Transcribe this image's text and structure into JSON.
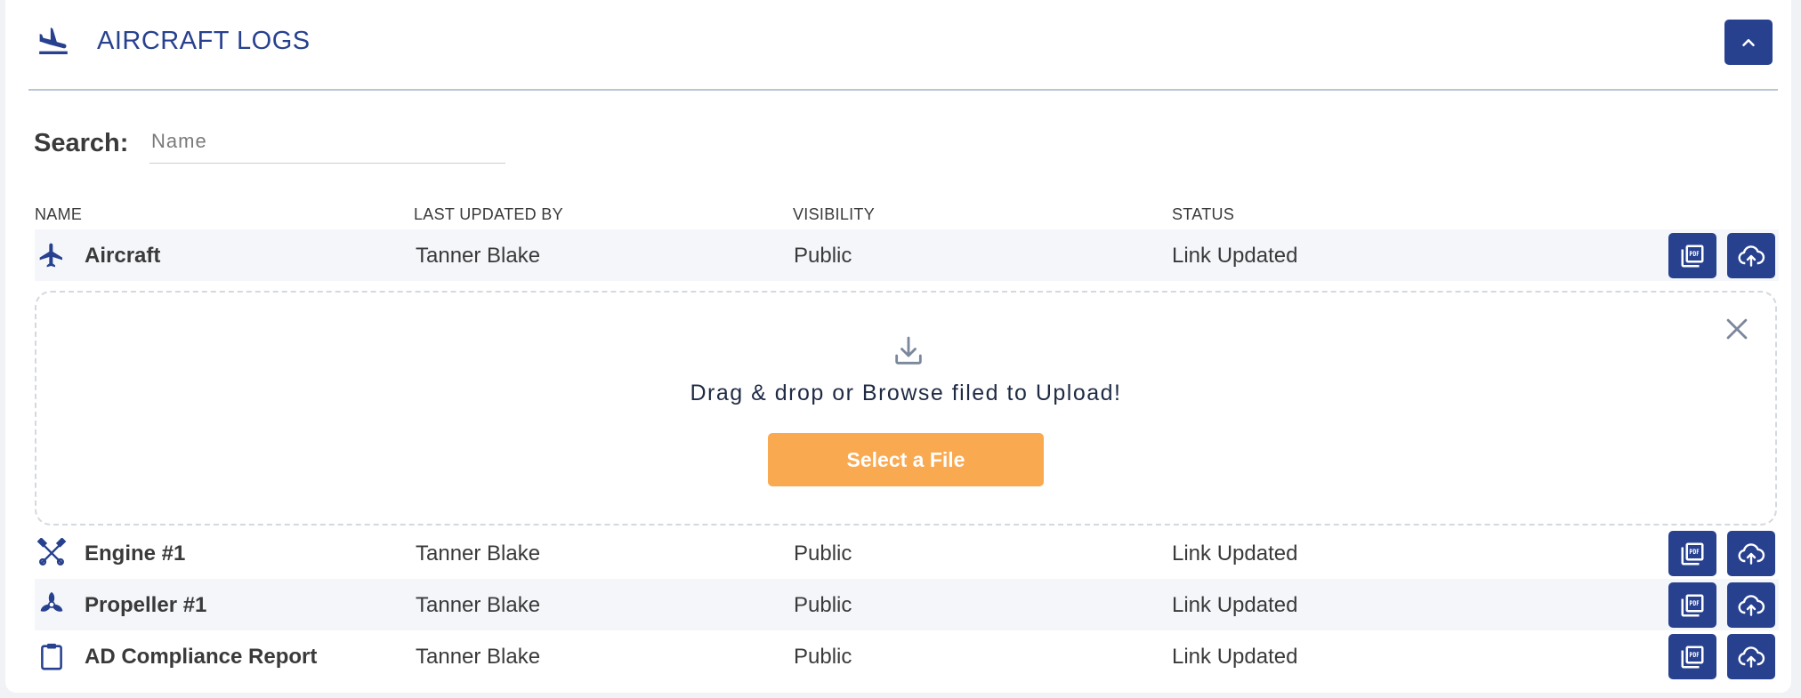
{
  "header": {
    "title": "AIRCRAFT LOGS"
  },
  "search": {
    "label": "Search:",
    "placeholder": "Name",
    "value": ""
  },
  "table": {
    "columns": [
      "NAME",
      "LAST UPDATED BY",
      "VISIBILITY",
      "STATUS"
    ],
    "rows": [
      {
        "name": "Aircraft",
        "icon": "airplane-icon",
        "updated_by": "Tanner Blake",
        "visibility": "Public",
        "status": "Link Updated"
      },
      {
        "name": "Engine #1",
        "icon": "engine-pistons-icon",
        "updated_by": "Tanner Blake",
        "visibility": "Public",
        "status": "Link Updated"
      },
      {
        "name": "Propeller #1",
        "icon": "propeller-icon",
        "updated_by": "Tanner Blake",
        "visibility": "Public",
        "status": "Link Updated"
      },
      {
        "name": "AD Compliance Report",
        "icon": "clipboard-icon",
        "updated_by": "Tanner Blake",
        "visibility": "Public",
        "status": "Link Updated"
      }
    ]
  },
  "dropzone": {
    "text": "Drag & drop or Browse filed to Upload!",
    "button_label": "Select a File"
  },
  "colors": {
    "primary": "#27418f",
    "accent": "#f9a94f",
    "divider": "#b8c6d8",
    "row_shade": "#f4f6fa"
  }
}
